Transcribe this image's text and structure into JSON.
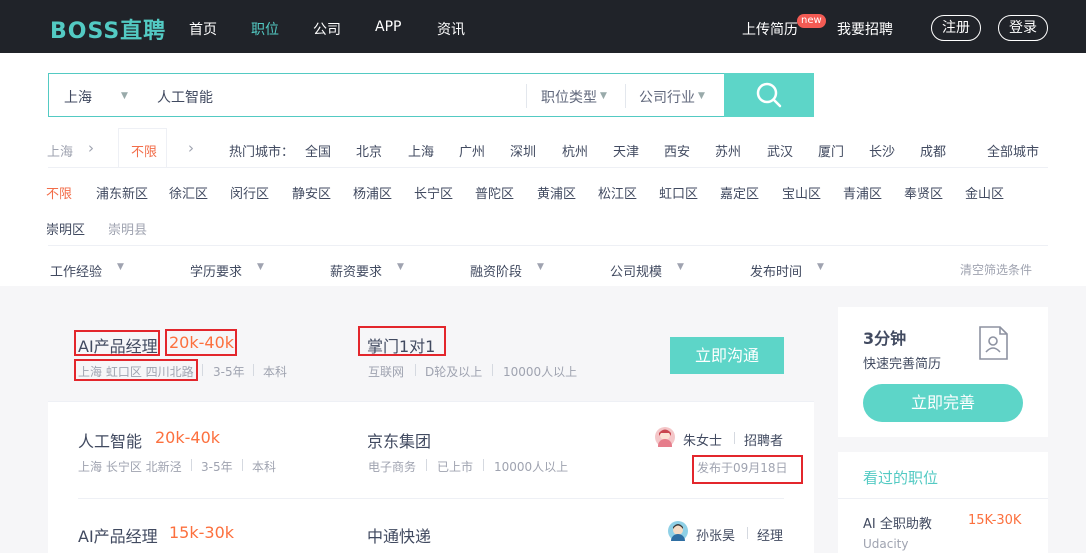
{
  "nav": {
    "logo": "BOSS直聘",
    "links": [
      "首页",
      "职位",
      "公司",
      "APP",
      "资讯"
    ],
    "upload_resume": "上传简历",
    "new_badge": "new",
    "recruit": "我要招聘",
    "register": "注册",
    "login": "登录"
  },
  "search": {
    "city": "上海",
    "query": "人工智能",
    "job_type": "职位类型",
    "industry": "公司行业"
  },
  "city_row": {
    "current": "上海",
    "unlimited": "不限",
    "hot_label": "热门城市：",
    "cities": [
      "全国",
      "北京",
      "上海",
      "广州",
      "深圳",
      "杭州",
      "天津",
      "西安",
      "苏州",
      "武汉",
      "厦门",
      "长沙",
      "成都"
    ],
    "all_cities": "全部城市"
  },
  "district_row": {
    "unlimited": "不限",
    "districts": [
      "浦东新区",
      "徐汇区",
      "闵行区",
      "静安区",
      "杨浦区",
      "长宁区",
      "普陀区",
      "黄浦区",
      "松江区",
      "虹口区",
      "嘉定区",
      "宝山区",
      "青浦区",
      "奉贤区",
      "金山区"
    ],
    "districts2": [
      "崇明区",
      "崇明县"
    ]
  },
  "filters": {
    "items": [
      "工作经验",
      "学历要求",
      "薪资要求",
      "融资阶段",
      "公司规模",
      "发布时间"
    ],
    "clear": "清空筛选条件"
  },
  "jobs": [
    {
      "title": "AI产品经理",
      "salary": "20k-40k",
      "location": "上海 虹口区 四川北路",
      "experience": "3-5年",
      "education": "本科",
      "company": "掌门1对1",
      "industry": "互联网",
      "stage": "D轮及以上",
      "size": "10000人以上",
      "chat_label": "立即沟通"
    },
    {
      "title": "人工智能",
      "salary": "20k-40k",
      "location": "上海 长宁区 北新泾",
      "experience": "3-5年",
      "education": "本科",
      "company": "京东集团",
      "industry": "电子商务",
      "stage": "已上市",
      "size": "10000人以上",
      "recruiter": "朱女士",
      "recruiter_role": "招聘者",
      "posted": "发布于09月18日"
    },
    {
      "title": "AI产品经理",
      "salary": "15k-30k",
      "company": "中通快递",
      "recruiter": "孙张昊",
      "recruiter_role": "经理"
    }
  ],
  "sidebar": {
    "minutes": "3分钟",
    "subtitle": "快速完善简历",
    "complete_btn": "立即完善",
    "viewed_title": "看过的职位",
    "viewed": [
      {
        "title": "AI 全职助教",
        "salary": "15K-30K",
        "company": "Udacity"
      }
    ]
  },
  "colors": {
    "accent": "#53cac3",
    "salary": "#fc703e",
    "highlight": "#e3262c",
    "nav_bg": "#202329"
  }
}
